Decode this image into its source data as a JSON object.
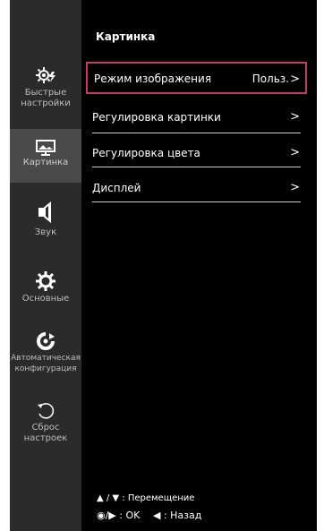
{
  "sidebar": {
    "items": [
      {
        "label": "Быстрые\nнастройки",
        "icon": "quick-settings-icon"
      },
      {
        "label": "Картинка",
        "icon": "picture-icon"
      },
      {
        "label": "Звук",
        "icon": "sound-icon"
      },
      {
        "label": "Основные",
        "icon": "general-settings-icon"
      },
      {
        "label": "Автоматическая\nконфигурация",
        "icon": "auto-config-icon"
      },
      {
        "label": "Сброс\nнастроек",
        "icon": "reset-icon"
      }
    ]
  },
  "main": {
    "title": "Картинка",
    "items": [
      {
        "label": "Режим изображения",
        "value": "Польз."
      },
      {
        "label": "Регулировка картинки"
      },
      {
        "label": "Регулировка цвета"
      },
      {
        "label": "Дисплей"
      }
    ],
    "chevron": ">"
  },
  "footer": {
    "line1": "▲ / ▼ : Перемещение",
    "ok": "◉/▶ : OK",
    "back": "◀ : Назад"
  },
  "colors": {
    "sidebar_bg": "#2b2b2b",
    "sidebar_selected_bg": "#4a4a4a",
    "main_bg": "#000000",
    "selection_border": "#c23a66"
  }
}
